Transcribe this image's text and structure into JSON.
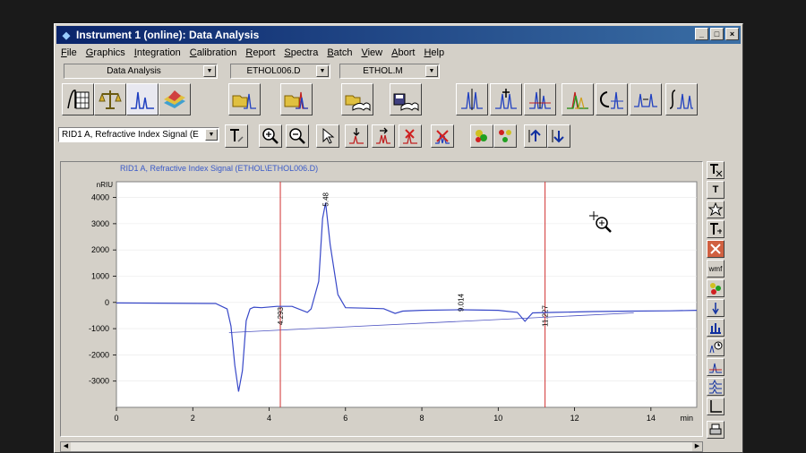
{
  "window": {
    "title": "Instrument 1 (online): Data Analysis",
    "controls": [
      "_",
      "□",
      "×"
    ]
  },
  "menu": [
    "File",
    "Graphics",
    "Integration",
    "Calibration",
    "Report",
    "Spectra",
    "Batch",
    "View",
    "Abort",
    "Help"
  ],
  "toolbar": {
    "view_select": "Data Analysis",
    "data_file": "ETHOL006.D",
    "method_file": "ETHOL.M",
    "signal_select": "RID1 A, Refractive Index Signal (E"
  },
  "signal_header": "RID1 A, Refractive Index Signal (ETHOL\\ETHOL006.D)",
  "sidebar_labels": {
    "text_tool": "T",
    "wmf": "wmf"
  },
  "chart_data": {
    "type": "line",
    "ylabel": "nRIU",
    "xlabel": "min",
    "xlim": [
      0,
      15.2
    ],
    "ylim": [
      -4000,
      4600
    ],
    "xticks": [
      0,
      2,
      4,
      6,
      8,
      10,
      12,
      14
    ],
    "yticks": [
      4000,
      3000,
      2000,
      1000,
      0,
      -1000,
      -2000,
      -3000
    ],
    "ytick_labels": [
      "4000",
      "3000",
      "2000",
      "1000",
      "0",
      "-1000",
      "-2000",
      "-3000"
    ],
    "series": [
      {
        "x": [
          0,
          2.6,
          2.9,
          3.0,
          3.1,
          3.2,
          3.3,
          3.4,
          3.5,
          3.6,
          3.8,
          4.2,
          4.6,
          5.0,
          5.1,
          5.3,
          5.4,
          5.48,
          5.6,
          5.8,
          6.0,
          6.5,
          7.0,
          7.3,
          7.5,
          8.0,
          9.0,
          10.0,
          10.5,
          10.7,
          10.9,
          11.5,
          12.5,
          13.5,
          14.5,
          15.2
        ],
        "y": [
          -20,
          -40,
          -250,
          -900,
          -2400,
          -3400,
          -2600,
          -700,
          -250,
          -180,
          -200,
          -150,
          -150,
          -380,
          -250,
          800,
          3200,
          3800,
          2200,
          300,
          -200,
          -220,
          -240,
          -420,
          -330,
          -300,
          -280,
          -300,
          -380,
          -720,
          -400,
          -380,
          -350,
          -330,
          -320,
          -300
        ]
      }
    ],
    "baseline_segments": [
      {
        "x": [
          2.95,
          13.55
        ],
        "y": [
          -1150,
          -400
        ]
      }
    ],
    "markers": [
      {
        "x": 4.293,
        "label": "4.293",
        "color": "#d03030"
      },
      {
        "x": 11.227,
        "label": "11.227",
        "color": "#d03030"
      }
    ],
    "annotations": [
      {
        "x": 5.48,
        "label": "5.48"
      },
      {
        "x": 9.014,
        "label": "9.014"
      }
    ]
  }
}
